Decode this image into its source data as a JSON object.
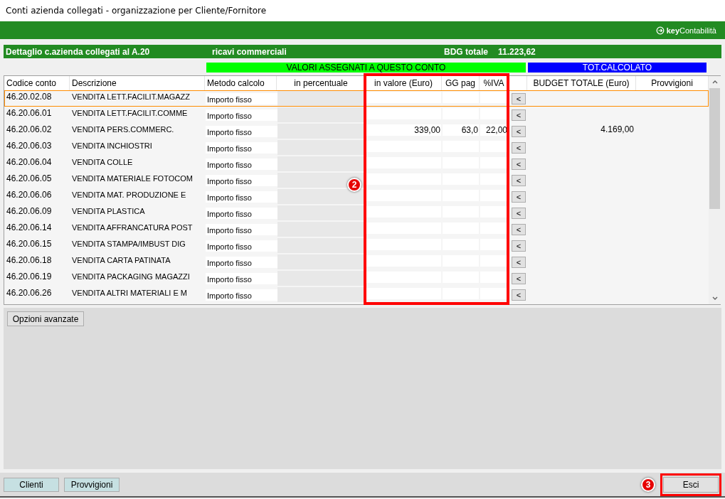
{
  "window": {
    "title": "Conti azienda collegati - organizzazione per Cliente/Fornitore"
  },
  "brand": {
    "bold": "key",
    "light": "Contabilità"
  },
  "detail_bar": {
    "title": "Dettaglio c.azienda collegati al  A.20",
    "subtitle": "ricavi commerciali",
    "total_label": "BDG totale",
    "total_value": "11.223,62"
  },
  "groups": [
    {
      "label": "VALORI ASSEGNATI A QUESTO CONTO",
      "color": "#00ff00"
    },
    {
      "label": "TOT.CALCOLATO",
      "color": "#0000ff"
    }
  ],
  "table": {
    "columns": [
      "Codice conto",
      "Descrizione",
      "Metodo calcolo",
      "in percentuale",
      "in valore (Euro)",
      "GG pag",
      "%IVA",
      "BUDGET TOTALE (Euro)",
      "Provvigioni"
    ],
    "rows": [
      {
        "code": "46.20.02.08",
        "description": "VENDITA LETT.FACILIT.MAGAZZ",
        "method": "Importo fisso",
        "value": "",
        "days": "",
        "vat": "",
        "action": "<",
        "budget": "",
        "selected": true
      },
      {
        "code": "46.20.06.01",
        "description": "VENDITA LETT.FACILIT.COMME",
        "method": "Importo fisso",
        "value": "",
        "days": "",
        "vat": "",
        "action": "<",
        "budget": "",
        "selected": false
      },
      {
        "code": "46.20.06.02",
        "description": "VENDITA PERS.COMMERC.",
        "method": "Importo fisso",
        "value": "339,00",
        "days": "63,0",
        "vat": "22,00",
        "action": "<",
        "budget": "4.169,00",
        "selected": false
      },
      {
        "code": "46.20.06.03",
        "description": "VENDITA INCHIOSTRI",
        "method": "Importo fisso",
        "value": "",
        "days": "",
        "vat": "",
        "action": "<",
        "budget": "",
        "selected": false
      },
      {
        "code": "46.20.06.04",
        "description": "VENDITA COLLE",
        "method": "Importo fisso",
        "value": "",
        "days": "",
        "vat": "",
        "action": "<",
        "budget": "",
        "selected": false
      },
      {
        "code": "46.20.06.05",
        "description": "VENDITA MATERIALE FOTOCOM",
        "method": "Importo fisso",
        "value": "",
        "days": "",
        "vat": "",
        "action": "<",
        "budget": "",
        "selected": false
      },
      {
        "code": "46.20.06.06",
        "description": "VENDITA MAT. PRODUZIONE E",
        "method": "Importo fisso",
        "value": "",
        "days": "",
        "vat": "",
        "action": "<",
        "budget": "",
        "selected": false
      },
      {
        "code": "46.20.06.09",
        "description": "VENDITA PLASTICA",
        "method": "Importo fisso",
        "value": "",
        "days": "",
        "vat": "",
        "action": "<",
        "budget": "",
        "selected": false
      },
      {
        "code": "46.20.06.14",
        "description": "VENDITA AFFRANCATURA POST",
        "method": "Importo fisso",
        "value": "",
        "days": "",
        "vat": "",
        "action": "<",
        "budget": "",
        "selected": false
      },
      {
        "code": "46.20.06.15",
        "description": "VENDITA STAMPA/IMBUST DIG",
        "method": "Importo fisso",
        "value": "",
        "days": "",
        "vat": "",
        "action": "<",
        "budget": "",
        "selected": false
      },
      {
        "code": "46.20.06.18",
        "description": "VENDITA CARTA PATINATA",
        "method": "Importo fisso",
        "value": "",
        "days": "",
        "vat": "",
        "action": "<",
        "budget": "",
        "selected": false
      },
      {
        "code": "46.20.06.19",
        "description": "VENDITA PACKAGING MAGAZZI",
        "method": "Importo fisso",
        "value": "",
        "days": "",
        "vat": "",
        "action": "<",
        "budget": "",
        "selected": false
      },
      {
        "code": "46.20.06.26",
        "description": "VENDITA ALTRI MATERIALI E M",
        "method": "Importo fisso",
        "value": "",
        "days": "",
        "vat": "",
        "action": "<",
        "budget": "",
        "selected": false
      }
    ]
  },
  "advanced_button": "Opzioni avanzate",
  "footer_buttons": [
    "Clienti",
    "Provvigioni"
  ],
  "exit_button": "Esci",
  "callouts": [
    "2",
    "3"
  ]
}
